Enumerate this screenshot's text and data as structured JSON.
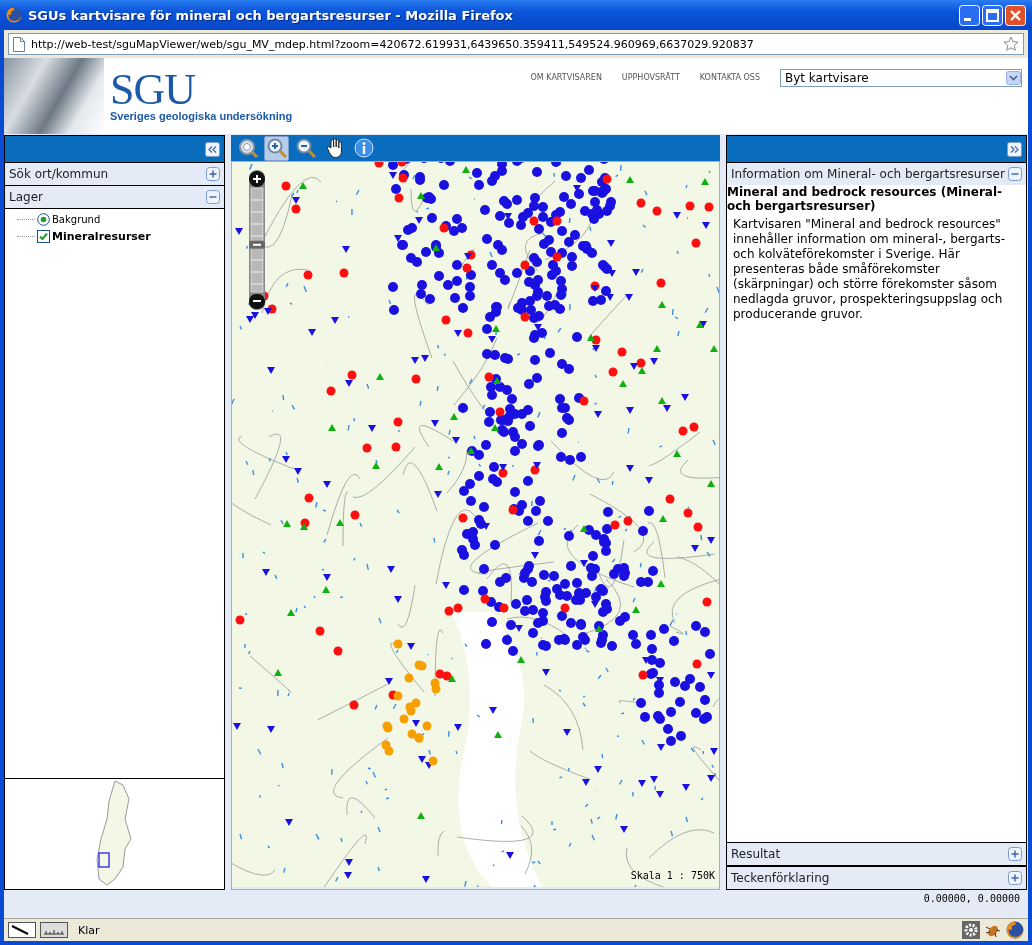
{
  "window": {
    "title": "SGUs kartvisare för mineral och bergartsresurser - Mozilla Firefox"
  },
  "address_bar": {
    "url": "http://web-test/sguMapViewer/web/sgu_MV_mdep.html?zoom=420672.619931,6439650.359411,549524.960969,6637029.920837"
  },
  "header": {
    "logo_text": "SGU",
    "logo_subtitle": "Sveriges geologiska undersökning",
    "links": [
      "OM KARTVISAREN",
      "UPPHOVSRÄTT",
      "KONTAKTA OSS"
    ],
    "viewer_select": {
      "value": "Byt kartvisare"
    }
  },
  "left_panel": {
    "sections": [
      {
        "title": "Sök ort/kommun",
        "expanded": false
      },
      {
        "title": "Lager",
        "expanded": true
      }
    ],
    "layers": [
      {
        "label": "Bakgrund",
        "kind": "radio",
        "checked": true
      },
      {
        "label": "Mineralresurser",
        "kind": "checkbox",
        "checked": true
      }
    ]
  },
  "map": {
    "tools": [
      {
        "kind": "zoom-extent",
        "selected": false
      },
      {
        "kind": "zoom-in",
        "selected": true
      },
      {
        "kind": "zoom-out",
        "selected": false
      },
      {
        "kind": "pan",
        "selected": false
      },
      {
        "kind": "info",
        "selected": false
      }
    ],
    "zoom_slider": {
      "level": 0.45
    },
    "scale": "Skala 1 : 750K"
  },
  "right_panel": {
    "info_section": {
      "title": "Information om Mineral- och bergartsresurser",
      "expanded": true
    },
    "info_title": "Mineral and bedrock resources (Mineral- och bergartsresurser)",
    "info_text": "Kartvisaren \"Mineral and bedrock resources\" innehåller information om mineral-, bergarts- och kolväteförekomster i Sverige. Här presenteras både småförekomster (skärpningar) och större förekomster såsom nedlagda gruvor, prospekteringsuppslag och producerande gruvor.",
    "sections": [
      {
        "title": "Resultat",
        "expanded": false
      },
      {
        "title": "Teckenförklaring",
        "expanded": false
      }
    ]
  },
  "coordinates": "0.00000, 0.00000",
  "status_bar": {
    "text": "Klar"
  }
}
